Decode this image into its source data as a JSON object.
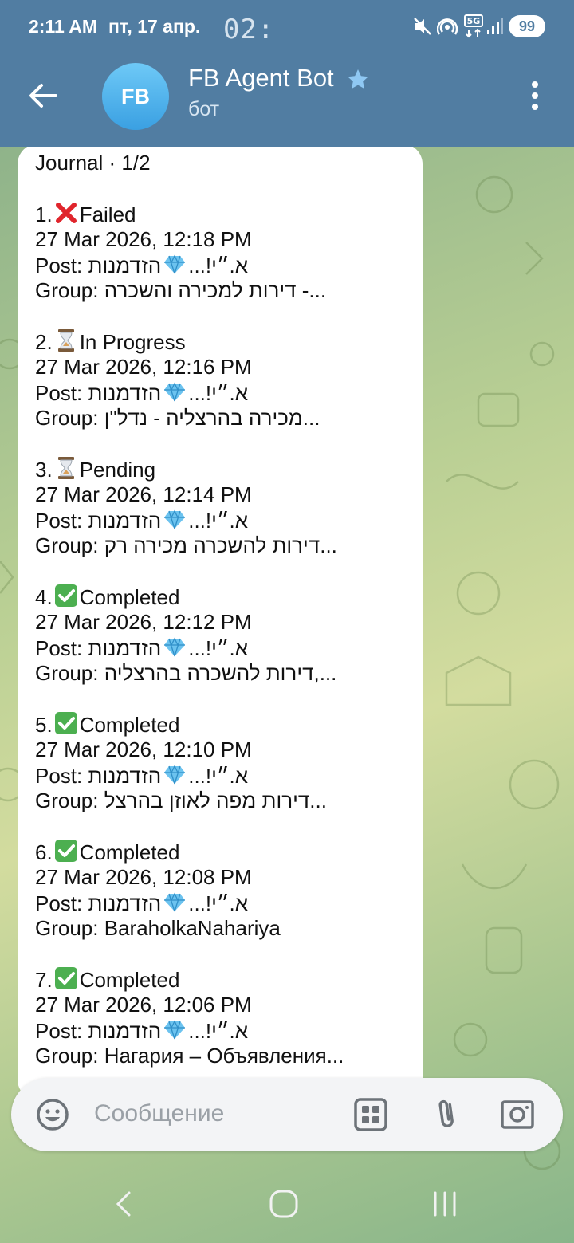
{
  "status_bar": {
    "time": "2:11 AM",
    "date": "пт, 17 апр.",
    "ticker": "02:",
    "icons": [
      "mute-icon",
      "hotspot-icon",
      "5g-icon",
      "signal-icon"
    ],
    "battery": "99"
  },
  "header": {
    "avatar_initials": "FB",
    "title": "FB Agent Bot",
    "subtitle": "бот",
    "verified_icon": "star-icon",
    "accent": "#517da2"
  },
  "message": {
    "heading": "Journal · 1/2",
    "entries": [
      {
        "num": "1.",
        "icon": "cross-mark-icon",
        "status": "Failed",
        "datetime": "27 Mar 2026, 12:18 PM",
        "post_label": "Post:",
        "post_text": "הזדמנות",
        "post_suffix": "א.״י!...",
        "group_label": "Group:",
        "group_text": "דירות למכירה והשכרה -..."
      },
      {
        "num": "2.",
        "icon": "hourglass-icon",
        "status": "In Progress",
        "datetime": "27 Mar 2026, 12:16 PM",
        "post_label": "Post:",
        "post_text": "הזדמנות",
        "post_suffix": "א.״י!...",
        "group_label": "Group:",
        "group_text": "מכירה בהרצליה - נדל\"ן..."
      },
      {
        "num": "3.",
        "icon": "hourglass-icon",
        "status": "Pending",
        "datetime": "27 Mar 2026, 12:14 PM",
        "post_label": "Post:",
        "post_text": "הזדמנות",
        "post_suffix": "א.״י!...",
        "group_label": "Group:",
        "group_text": "דירות להשכרה מכירה רק..."
      },
      {
        "num": "4.",
        "icon": "check-mark-icon",
        "status": "Completed",
        "datetime": "27 Mar 2026, 12:12 PM",
        "post_label": "Post:",
        "post_text": "הזדמנות",
        "post_suffix": "א.״י!...",
        "group_label": "Group:",
        "group_text": "דירות להשכרה בהרצליה,..."
      },
      {
        "num": "5.",
        "icon": "check-mark-icon",
        "status": "Completed",
        "datetime": "27 Mar 2026, 12:10 PM",
        "post_label": "Post:",
        "post_text": "הזדמנות",
        "post_suffix": "א.״י!...",
        "group_label": "Group:",
        "group_text": "דירות מפה לאוזן בהרצל..."
      },
      {
        "num": "6.",
        "icon": "check-mark-icon",
        "status": "Completed",
        "datetime": "27 Mar 2026, 12:08 PM",
        "post_label": "Post:",
        "post_text": "הזדמנות",
        "post_suffix": "א.״י!...",
        "group_label": "Group:",
        "group_text": "BaraholkaNahariya"
      },
      {
        "num": "7.",
        "icon": "check-mark-icon",
        "status": "Completed",
        "datetime": "27 Mar 2026, 12:06 PM",
        "post_label": "Post:",
        "post_text": "הזדמנות",
        "post_suffix": "א.״י!...",
        "group_label": "Group:",
        "group_text": "Нагария – Объявления..."
      }
    ]
  },
  "composer": {
    "placeholder": "Сообщение",
    "icons": [
      "emoji-icon",
      "bot-menu-icon",
      "attach-icon",
      "camera-icon"
    ]
  },
  "navbar": {
    "icons": [
      "back-nav-icon",
      "home-nav-icon",
      "recents-nav-icon"
    ]
  }
}
